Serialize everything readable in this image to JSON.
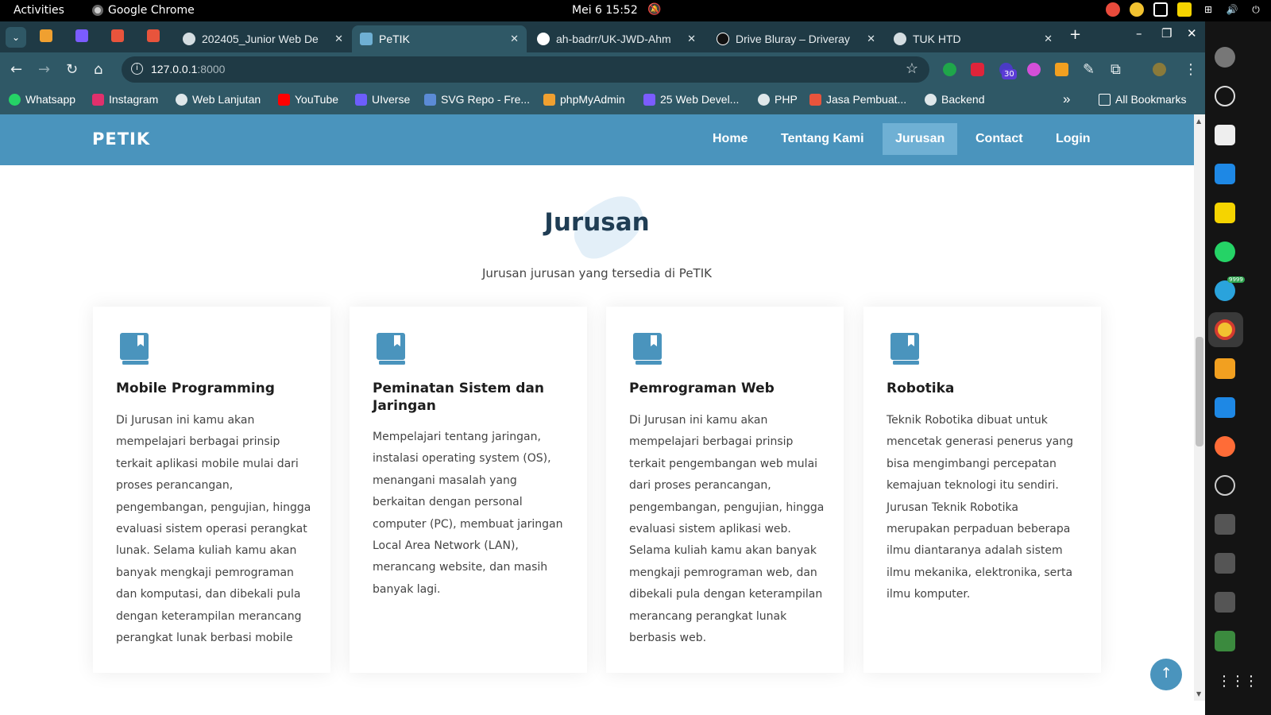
{
  "system_bar": {
    "activities": "Activities",
    "app_name": "Google Chrome",
    "datetime": "Mei 6  15:52"
  },
  "browser": {
    "tabs": [
      {
        "label": "202405_Junior Web De"
      },
      {
        "label": "PeTIK"
      },
      {
        "label": "ah-badrr/UK-JWD-Ahm"
      },
      {
        "label": "Drive Bluray – Driveray"
      },
      {
        "label": "TUK HTD"
      }
    ],
    "new_tab": "+",
    "url_host": "127.0.0.1",
    "url_port": ":8000",
    "extension_badge": "30",
    "bookmarks": [
      {
        "label": "Whatsapp",
        "color": "#25d366"
      },
      {
        "label": "Instagram",
        "color": "#e1306c"
      },
      {
        "label": "Web Lanjutan",
        "color": "#dfe7ea"
      },
      {
        "label": "YouTube",
        "color": "#ff0000"
      },
      {
        "label": "UIverse",
        "color": "#6d5dfc"
      },
      {
        "label": "SVG Repo - Fre...",
        "color": "#5b8bd6"
      },
      {
        "label": "phpMyAdmin",
        "color": "#f0a030"
      },
      {
        "label": "25 Web Devel...",
        "color": "#7b5cff"
      },
      {
        "label": "PHP",
        "color": "#dfe7ea"
      },
      {
        "label": "Jasa Pembuat...",
        "color": "#e8543c"
      },
      {
        "label": "Backend",
        "color": "#dfe7ea"
      }
    ],
    "more_bookmarks": "»",
    "all_bookmarks": "All Bookmarks"
  },
  "site": {
    "logo": "PETIK",
    "nav": [
      {
        "label": "Home"
      },
      {
        "label": "Tentang Kami"
      },
      {
        "label": "Jurusan",
        "active": true
      },
      {
        "label": "Contact"
      },
      {
        "label": "Login"
      }
    ],
    "section": {
      "title": "Jurusan",
      "subtitle": "Jurusan jurusan yang tersedia di PeTIK"
    },
    "cards": [
      {
        "icon": "book-icon",
        "title": "Mobile Programming",
        "text": "Di Jurusan ini kamu akan mempelajari berbagai prinsip terkait aplikasi mobile mulai dari proses perancangan, pengembangan, pengujian, hingga evaluasi sistem operasi perangkat lunak. Selama kuliah kamu akan banyak mengkaji pemrograman dan komputasi, dan dibekali pula dengan keterampilan merancang perangkat lunak berbasi mobile"
      },
      {
        "icon": "book-icon",
        "title": "Peminatan Sistem dan Jaringan",
        "text": "Mempelajari tentang jaringan, instalasi operating system (OS), menangani masalah yang berkaitan dengan personal computer (PC), membuat jaringan Local Area Network (LAN), merancang website, dan masih banyak lagi."
      },
      {
        "icon": "book-icon",
        "title": "Pemrograman Web",
        "text": "Di Jurusan ini kamu akan mempelajari berbagai prinsip terkait pengembangan web mulai dari proses perancangan, pengembangan, pengujian, hingga evaluasi sistem aplikasi web. Selama kuliah kamu akan banyak mengkaji pemrograman web, dan dibekali pula dengan keterampilan merancang perangkat lunak berbasis web."
      },
      {
        "icon": "book-icon",
        "title": "Robotika",
        "text": "Teknik Robotika dibuat untuk mencetak generasi penerus yang bisa mengimbangi percepatan kemajuan teknologi itu sendiri. Jurusan Teknik Robotika merupakan perpaduan beberapa ilmu diantaranya adalah sistem ilmu mekanika, elektronika, serta ilmu komputer."
      }
    ],
    "colors": {
      "primary": "#4a94bd",
      "active_nav": "#6fb0d4",
      "heading": "#1f3d54",
      "icon": "#4a94bd"
    }
  },
  "dock": {
    "telegram_badge": "9999"
  }
}
